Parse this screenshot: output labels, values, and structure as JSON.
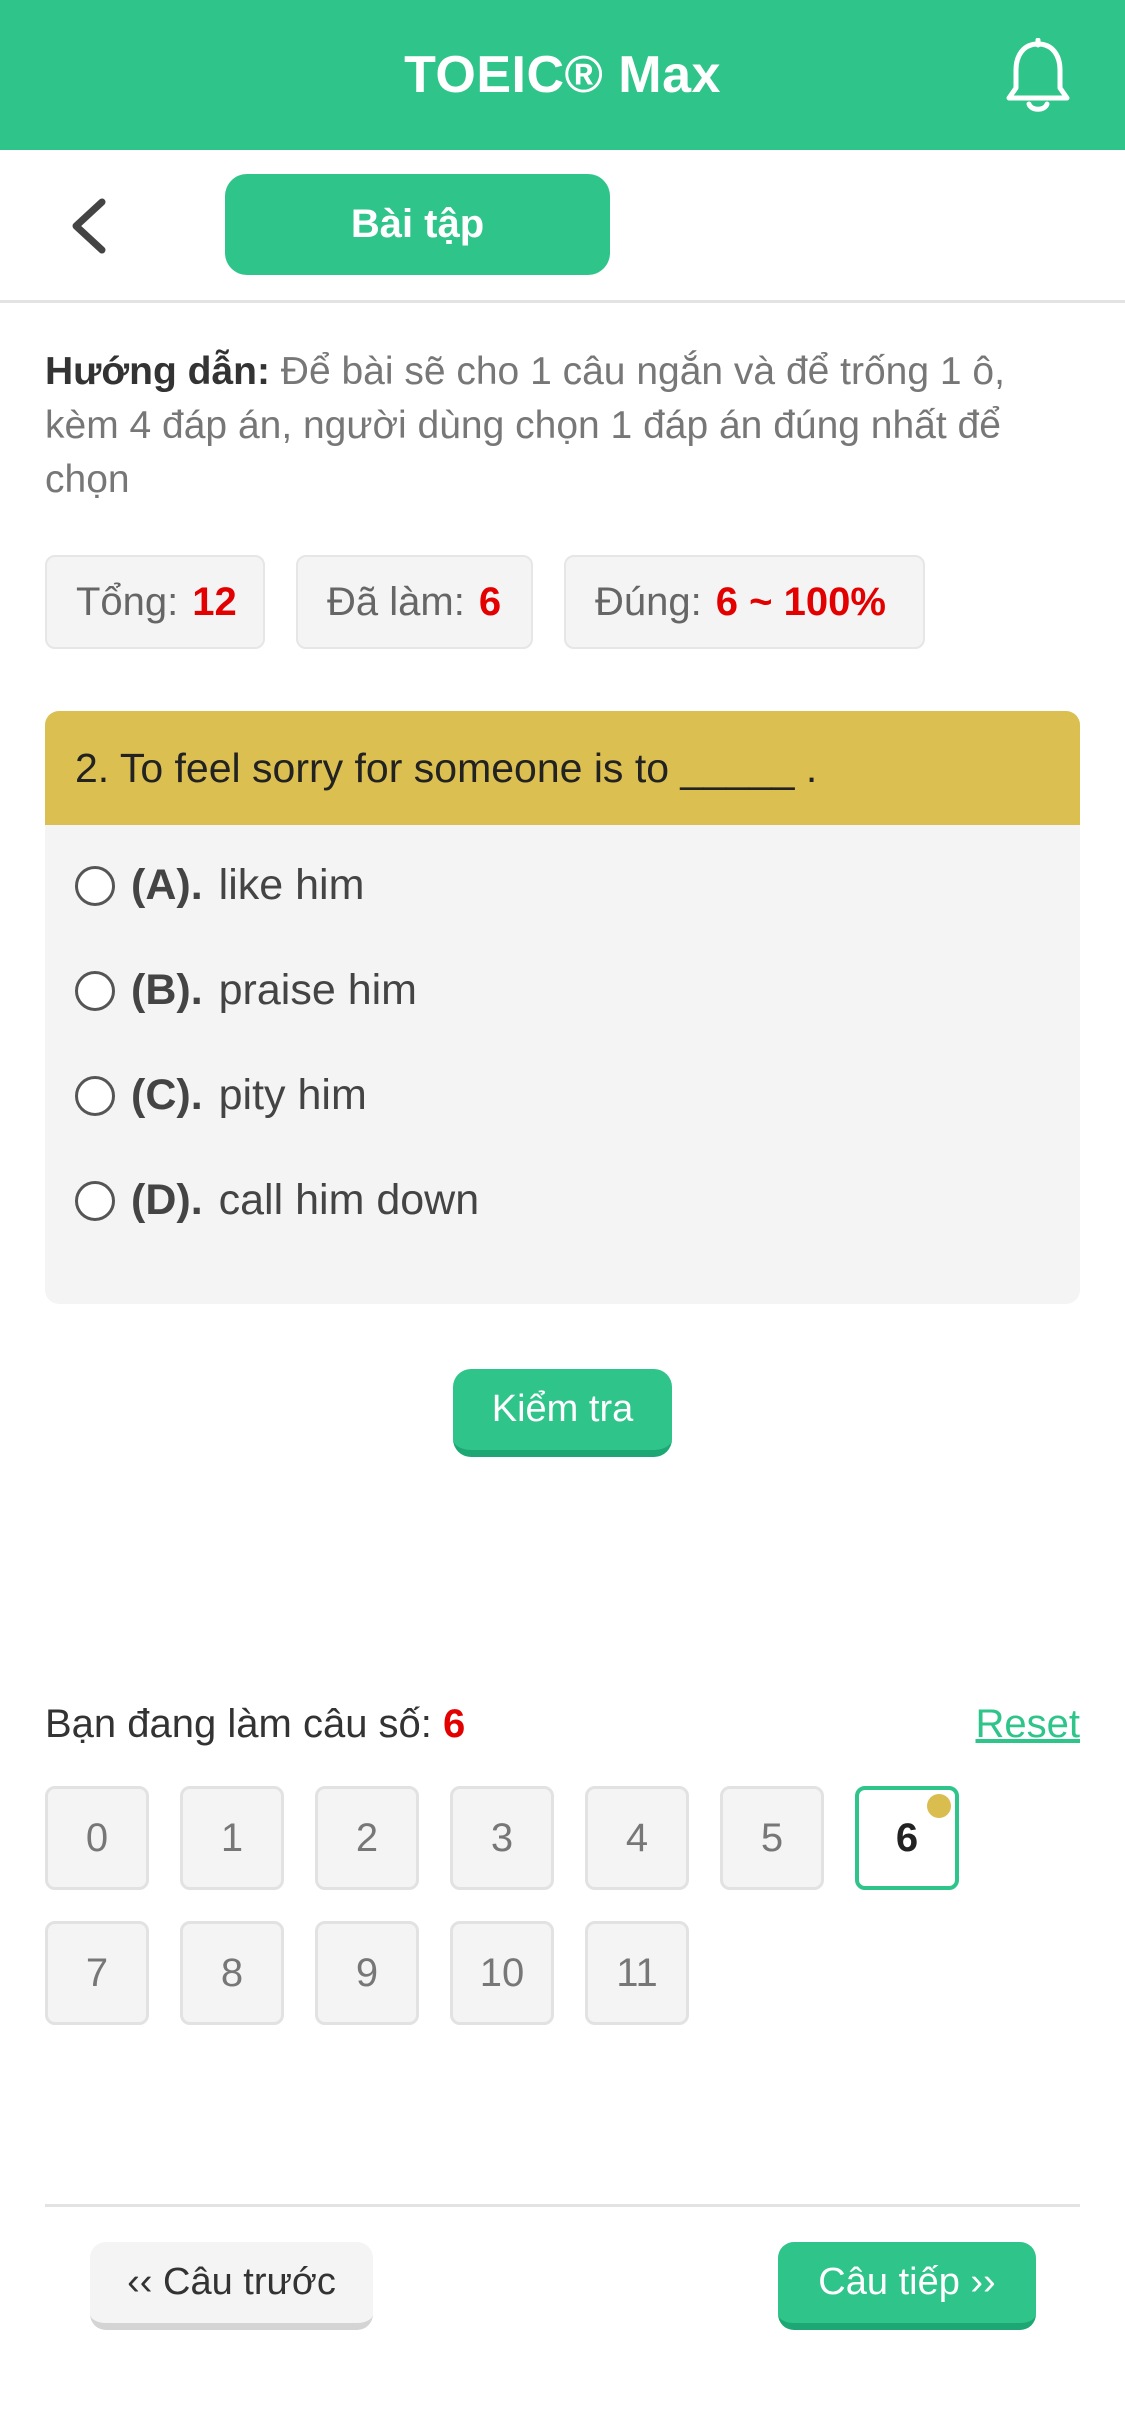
{
  "app": {
    "title": "TOEIC® Max",
    "accent": "#2ec48a"
  },
  "header": {
    "tab_label": "Bài tập"
  },
  "guide": {
    "label": "Hướng dẫn:",
    "text": " Để bài sẽ cho 1 câu ngắn và để trống 1 ô, kèm 4 đáp án, người dùng chọn 1 đáp án đúng nhất để chọn"
  },
  "stats": {
    "total_label": "Tổng:",
    "total_value": "12",
    "done_label": "Đã làm:",
    "done_value": "6",
    "correct_label": "Đúng:",
    "correct_value": "6 ~ 100%"
  },
  "question": {
    "text": "2. To feel sorry for someone is to _____ .",
    "options": [
      {
        "label": "(A).",
        "text": "like him"
      },
      {
        "label": "(B).",
        "text": "praise him"
      },
      {
        "label": "(C).",
        "text": "pity him"
      },
      {
        "label": "(D).",
        "text": "call him down"
      }
    ]
  },
  "check_button": "Kiểm tra",
  "progress": {
    "current_label": "Bạn đang làm câu số:",
    "current_value": "6",
    "reset_label": "Reset",
    "numbers": [
      "0",
      "1",
      "2",
      "3",
      "4",
      "5",
      "6",
      "7",
      "8",
      "9",
      "10",
      "11"
    ]
  },
  "nav": {
    "prev_label": "‹‹ Câu trước",
    "next_label": "Câu tiếp ››"
  }
}
